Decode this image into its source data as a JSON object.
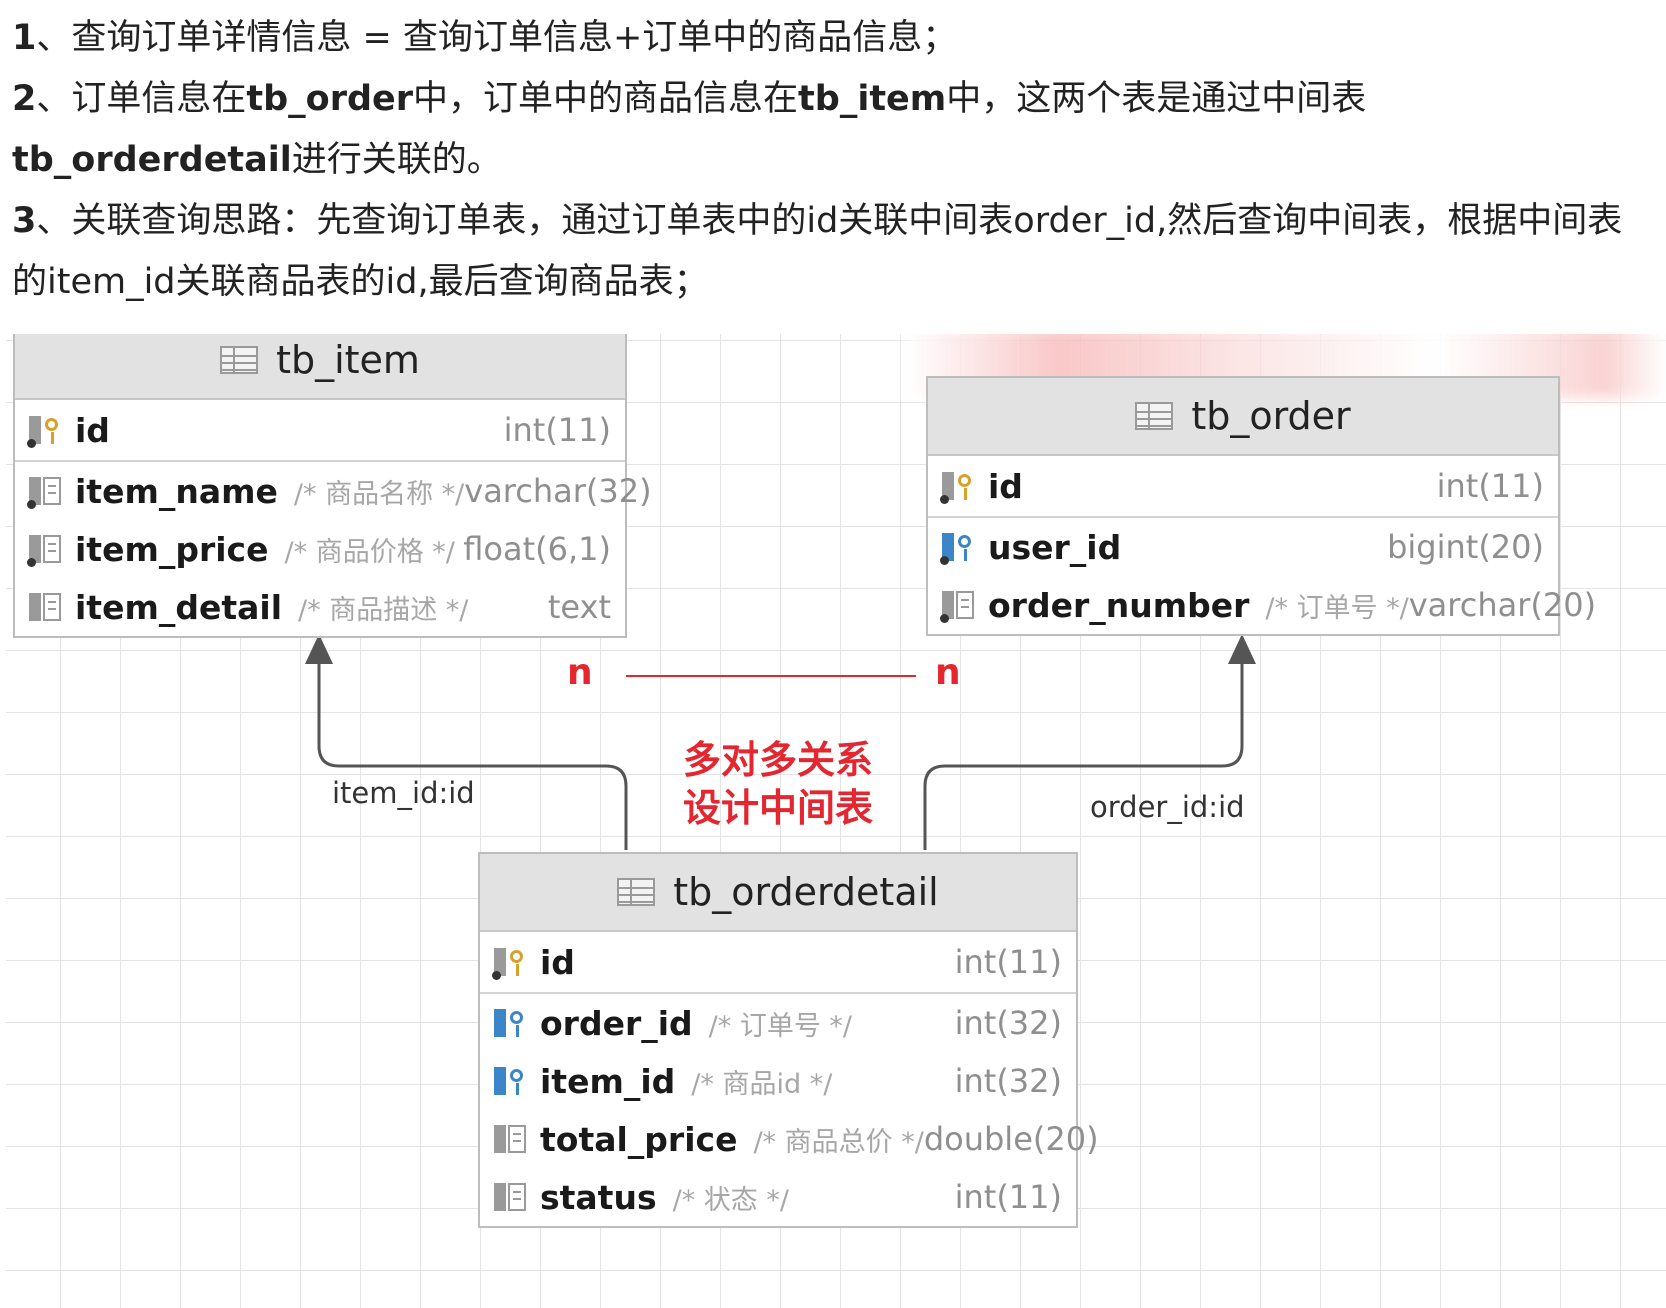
{
  "intro": {
    "p1": {
      "num": "1",
      "text": "、查询订单详情信息 = 查询订单信息+订单中的商品信息；"
    },
    "p2": {
      "num": "2",
      "t1": "、订单信息在",
      "b1": "tb_order",
      "t2": "中，订单中的商品信息在",
      "b2": "tb_item",
      "t3": "中，这两个表是通过中间表 ",
      "b3": "tb_orderdetail",
      "t4": "进行关联的。"
    },
    "p3": {
      "num": "3",
      "text": "、关联查询思路：先查询订单表，通过订单表中的id关联中间表order_id,然后查询中间表，根据中间表的item_id关联商品表的id,最后查询商品表；"
    }
  },
  "tables": {
    "tb_item": {
      "name": "tb_item",
      "columns": [
        {
          "name": "id",
          "comment": "",
          "type": "int(11)",
          "icon": "primary-key-icon"
        },
        {
          "name": "item_name",
          "comment": "/* 商品名称 */",
          "type": "varchar(32)",
          "icon": "column-icon"
        },
        {
          "name": "item_price",
          "comment": "/* 商品价格 */",
          "type": "float(6,1)",
          "icon": "column-icon"
        },
        {
          "name": "item_detail",
          "comment": "/* 商品描述 */",
          "type": "text",
          "icon": "column-icon"
        }
      ]
    },
    "tb_order": {
      "name": "tb_order",
      "columns": [
        {
          "name": "id",
          "comment": "",
          "type": "int(11)",
          "icon": "primary-key-icon"
        },
        {
          "name": "user_id",
          "comment": "",
          "type": "bigint(20)",
          "icon": "foreign-key-icon"
        },
        {
          "name": "order_number",
          "comment": "/* 订单号 */",
          "type": "varchar(20)",
          "icon": "column-icon"
        }
      ]
    },
    "tb_orderdetail": {
      "name": "tb_orderdetail",
      "columns": [
        {
          "name": "id",
          "comment": "",
          "type": "int(11)",
          "icon": "primary-key-icon"
        },
        {
          "name": "order_id",
          "comment": "/* 订单号 */",
          "type": "int(32)",
          "icon": "foreign-key-icon"
        },
        {
          "name": "item_id",
          "comment": "/* 商品id */",
          "type": "int(32)",
          "icon": "foreign-key-icon"
        },
        {
          "name": "total_price",
          "comment": "/* 商品总价 */",
          "type": "double(20)",
          "icon": "column-icon"
        },
        {
          "name": "status",
          "comment": "/* 状态 */",
          "type": "int(11)",
          "icon": "column-icon"
        }
      ]
    }
  },
  "edges": {
    "item_link": "item_id:id",
    "order_link": "order_id:id"
  },
  "relationship": {
    "left_mult": "n",
    "right_mult": "n",
    "note_line1": "多对多关系",
    "note_line2": "设计中间表"
  },
  "colors": {
    "accent_red": "#e3262f",
    "header_gray": "#e2e2e2",
    "key_gold": "#d9a12b",
    "fk_blue": "#3a86c8"
  }
}
